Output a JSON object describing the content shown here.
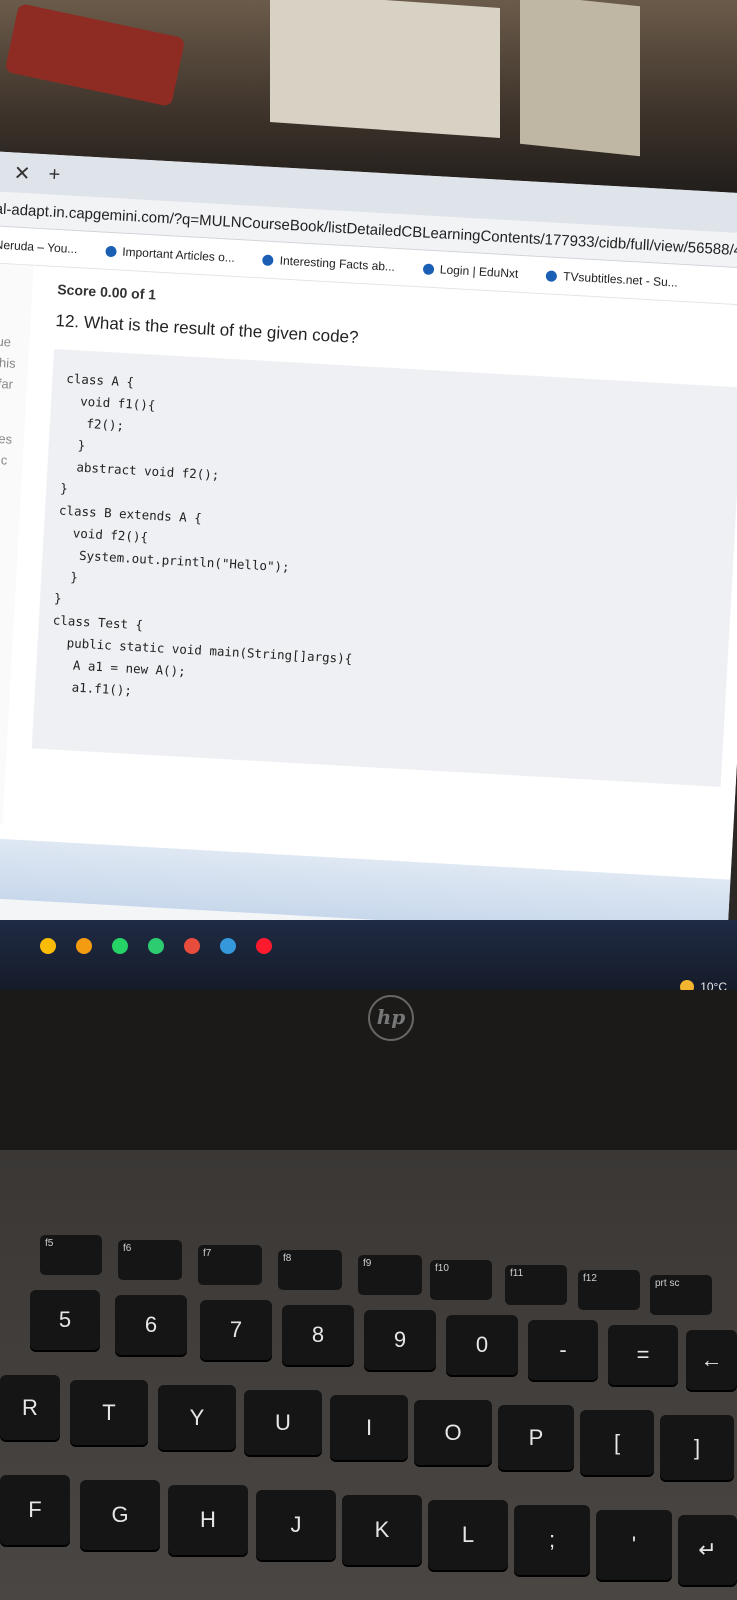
{
  "browser": {
    "close_icon": "✕",
    "newtab_icon": "+",
    "url": "al-adapt.in.capgemini.com/?q=MULNCourseBook/listDetailedCBLearningContents/177933/cidb/full/view/56588/4",
    "bookmarks": [
      {
        "label": "Neruda – You..."
      },
      {
        "label": "Important Articles o..."
      },
      {
        "label": "Interesting Facts ab..."
      },
      {
        "label": "Login | EduNxt"
      },
      {
        "label": "TVsubtitles.net - Su..."
      }
    ]
  },
  "page": {
    "left_fragments": [
      "que",
      "f this",
      "o far",
      "ques",
      "ou c"
    ],
    "score": "Score 0.00 of 1",
    "question": "12. What is the result of the given code?",
    "code_lines": [
      "class A {",
      "  void f1(){",
      "   f2();",
      "  }",
      "  abstract void f2();",
      "}",
      "class B extends A {",
      "  void f2(){",
      "   System.out.println(\"Hello\");",
      "  }",
      "}",
      "class Test {",
      "  public static void main(String[]args){",
      "   A a1 = new A();",
      "   a1.f1();"
    ]
  },
  "taskbar": {
    "icons": [
      "chrome-icon",
      "vlc-icon",
      "whatsapp-icon",
      "store-icon",
      "heart-icon",
      "app-icon",
      "opera-icon"
    ],
    "weather": "10°C"
  },
  "laptop": {
    "logo": "hp"
  },
  "keyboard": {
    "fkeys": [
      "f5",
      "f6",
      "f7",
      "f8",
      "f9",
      "f10",
      "f11",
      "f12",
      "prt sc"
    ],
    "number_row": [
      "5",
      "6",
      "7",
      "8",
      "9",
      "0",
      "-",
      "=",
      "←"
    ],
    "number_row_top": [
      "%",
      "^",
      "&",
      "*",
      "(",
      ")",
      "",
      "+",
      ""
    ],
    "letter_row1": [
      "R",
      "T",
      "Y",
      "U",
      "I",
      "O",
      "P",
      "[",
      "]"
    ],
    "letter_row1_top": [
      "",
      "",
      "",
      "",
      "",
      "",
      "",
      "{",
      "}"
    ],
    "letter_row2": [
      "F",
      "G",
      "H",
      "J",
      "K",
      "L",
      ";",
      "'",
      "↵"
    ]
  }
}
